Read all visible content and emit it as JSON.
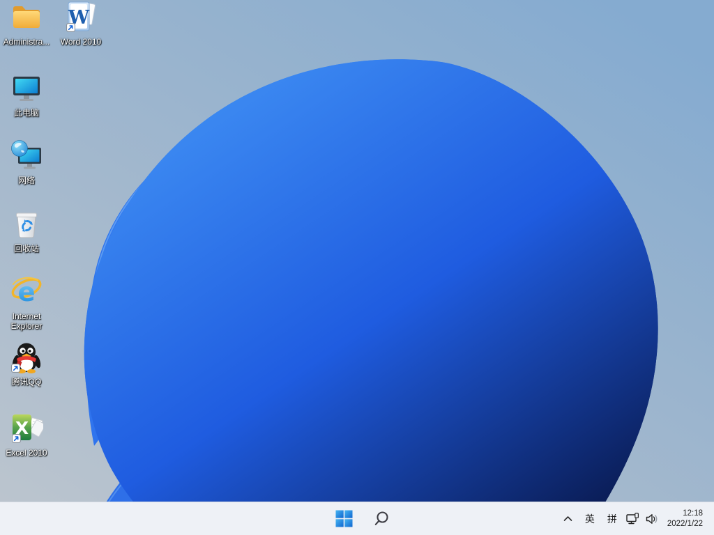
{
  "desktop": {
    "icons": [
      {
        "id": "administrator-folder",
        "label": "Administra...",
        "icon": "folder-icon",
        "shortcut": false
      },
      {
        "id": "word-2010",
        "label": "Word 2010",
        "icon": "word-document-icon",
        "shortcut": true
      },
      {
        "id": "this-pc",
        "label": "此电脑",
        "icon": "monitor-icon",
        "shortcut": false
      },
      {
        "id": "network",
        "label": "网络",
        "icon": "network-globe-monitor-icon",
        "shortcut": false
      },
      {
        "id": "recycle-bin",
        "label": "回收站",
        "icon": "recycle-bin-icon",
        "shortcut": false
      },
      {
        "id": "internet-explorer",
        "label": "Internet Explorer",
        "icon": "ie-logo-icon",
        "shortcut": false
      },
      {
        "id": "tencent-qq",
        "label": "腾讯QQ",
        "icon": "qq-penguin-icon",
        "shortcut": true
      },
      {
        "id": "excel-2010",
        "label": "Excel 2010",
        "icon": "excel-workbook-icon",
        "shortcut": true
      }
    ]
  },
  "taskbar": {
    "start": {
      "icon": "windows-logo-icon"
    },
    "search": {
      "icon": "search-icon"
    },
    "tray": {
      "overflow_icon": "chevron-up-icon",
      "language_indicator": "英",
      "ime_indicator": "拼",
      "network_icon": "ethernet-monitor-icon",
      "volume_icon": "speaker-icon"
    },
    "clock": {
      "time": "12:18",
      "date": "2022/1/22"
    }
  },
  "colors": {
    "sky_top": "#85abd0",
    "sky_bottom": "#bcc5ce",
    "bloom_bright": "#2d79f3",
    "bloom_dark": "#0a1c55",
    "taskbar_bg": "#eef1f6",
    "start_blue": "#1273d8",
    "highlight_blue": "#9ccbfa"
  }
}
